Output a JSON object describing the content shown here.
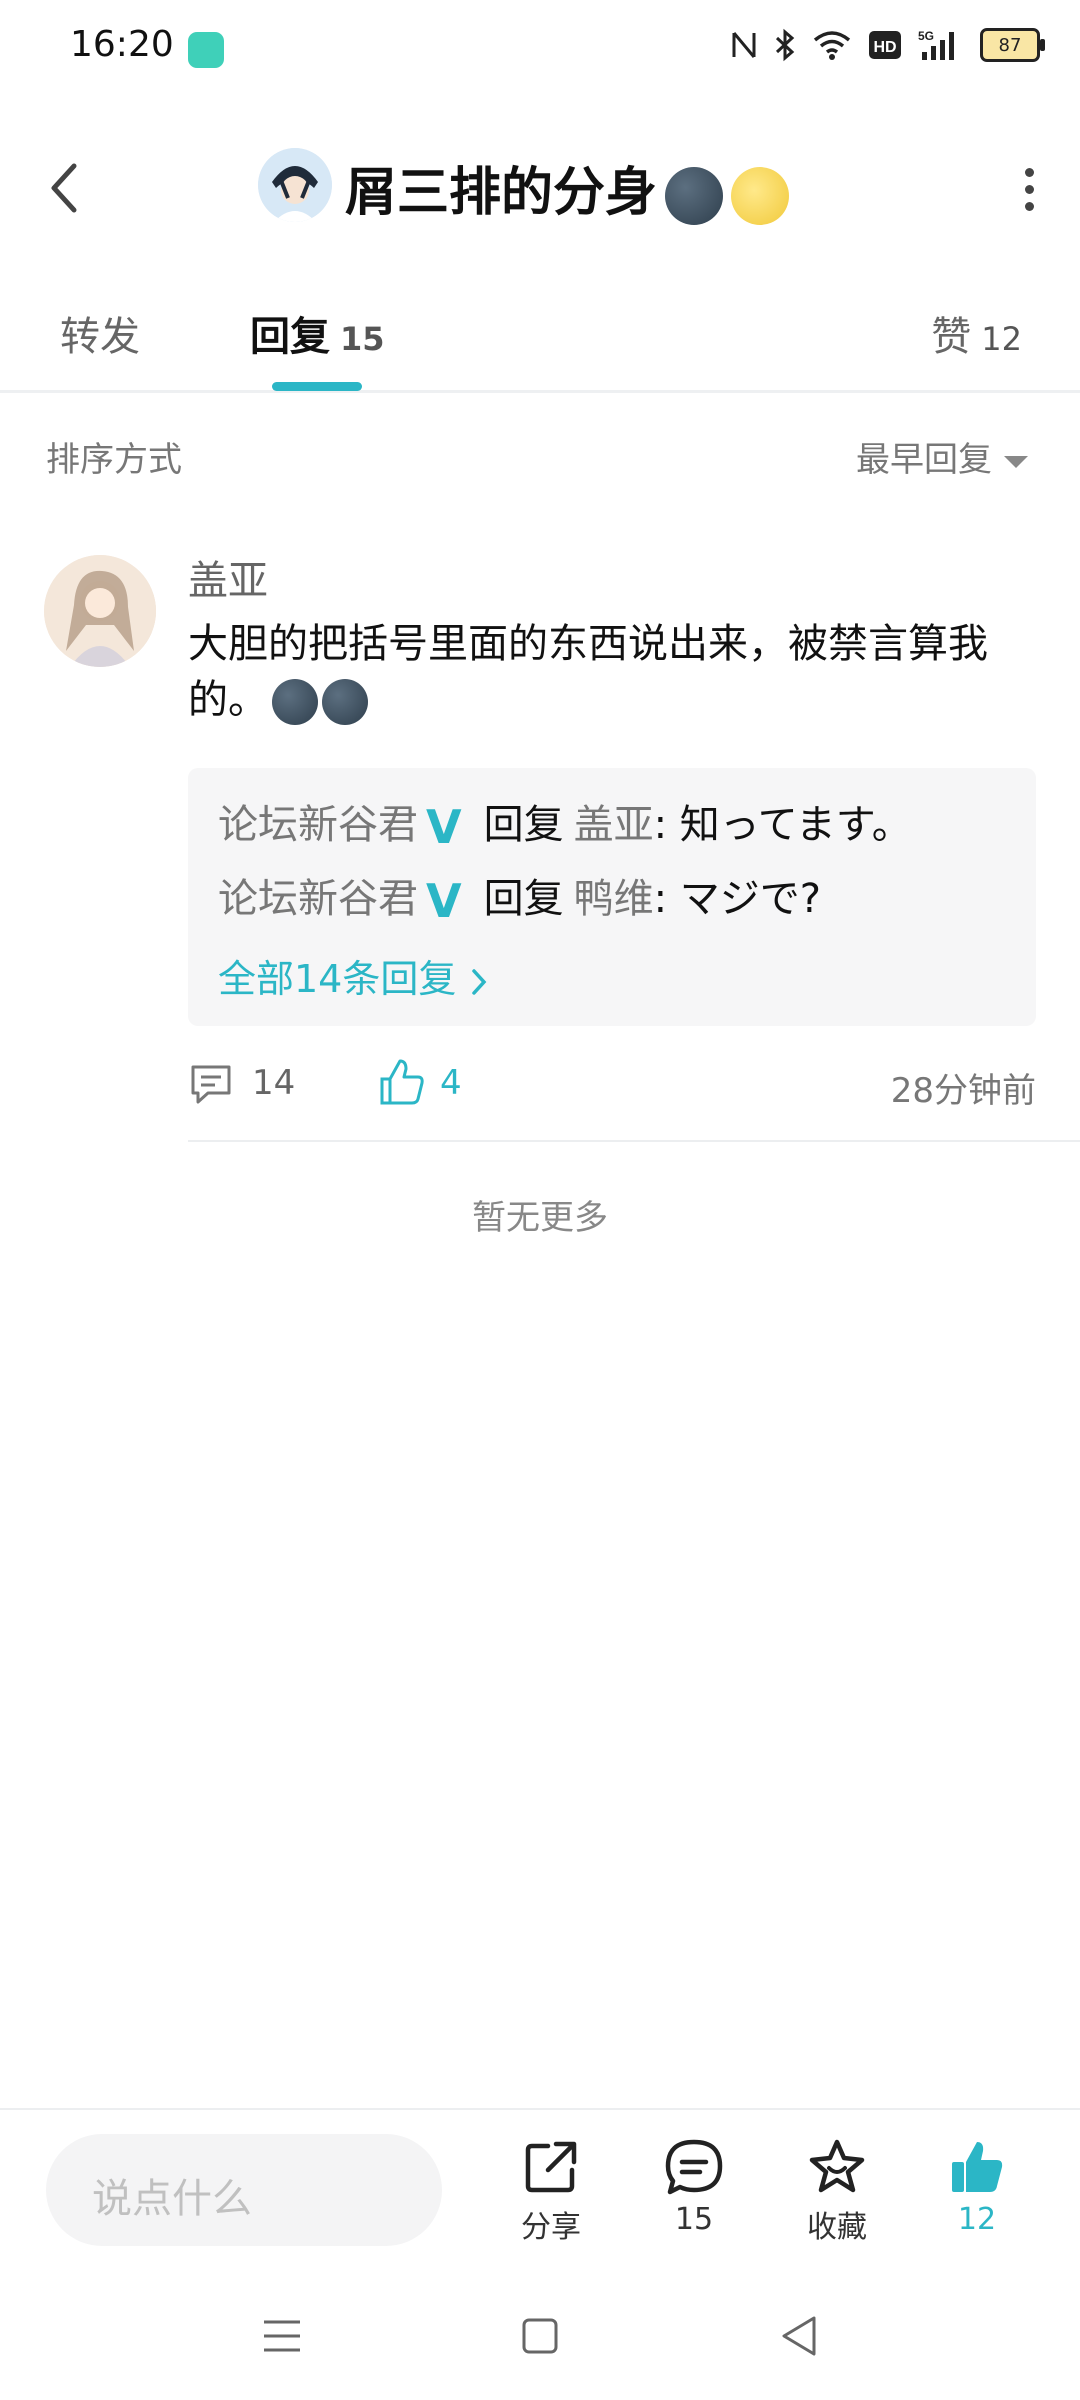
{
  "status_bar": {
    "time": "16:20",
    "battery": "87"
  },
  "header": {
    "title": "屑三排的分身"
  },
  "tabs": [
    {
      "label": "转发"
    },
    {
      "label": "回复",
      "count": "15"
    },
    {
      "label": "赞",
      "count": "12"
    }
  ],
  "sort": {
    "label": "排序方式",
    "value": "最早回复"
  },
  "comment": {
    "username": "盖亚",
    "text": "大胆的把括号里面的东西说出来，被禁言算我的。",
    "replies": [
      {
        "user": "论坛新谷君",
        "verb": "回复",
        "target": "盖亚",
        "text": ": 知ってます。"
      },
      {
        "user": "论坛新谷君",
        "verb": "回复",
        "target": "鸭维",
        "text": ": マジで?"
      }
    ],
    "view_all": "全部14条回复",
    "comment_count": "14",
    "like_count": "4",
    "time_ago": "28分钟前"
  },
  "no_more": "暂无更多",
  "bottom_bar": {
    "input_placeholder": "说点什么",
    "share_label": "分享",
    "comments_count": "15",
    "favorite_label": "收藏",
    "likes_count": "12"
  },
  "colors": {
    "accent": "#2bb6c6",
    "verified": "#2bb6c6"
  }
}
